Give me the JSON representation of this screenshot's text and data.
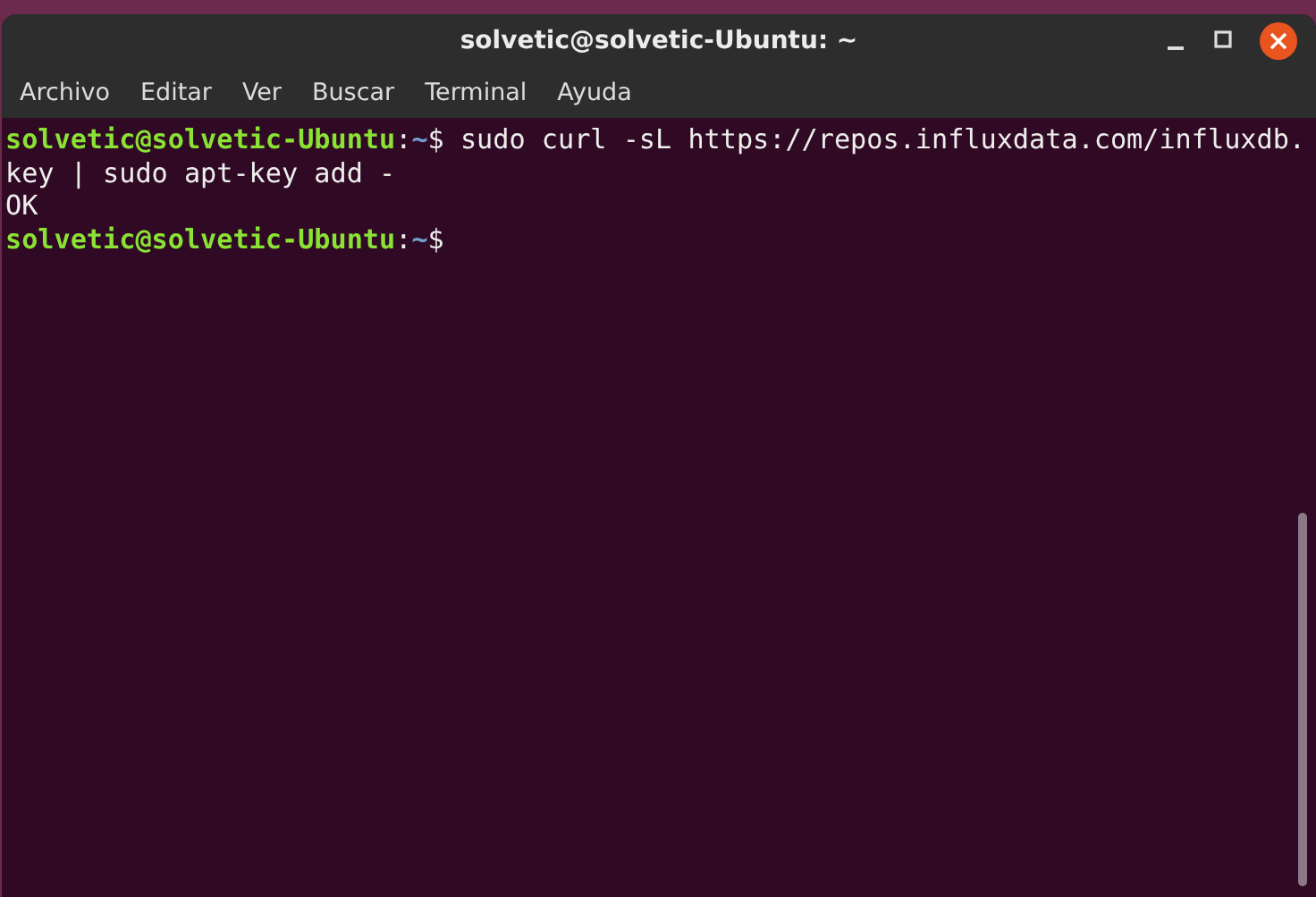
{
  "window": {
    "title": "solvetic@solvetic-Ubuntu: ~"
  },
  "menu": [
    "Archivo",
    "Editar",
    "Ver",
    "Buscar",
    "Terminal",
    "Ayuda"
  ],
  "terminal": {
    "lines": [
      {
        "kind": "prompt",
        "user": "solvetic@solvetic-Ubuntu",
        "separator": ":",
        "path": "~",
        "symbol": "$",
        "command": "sudo curl -sL https://repos.influxdata.com/influxdb."
      },
      {
        "kind": "output",
        "text": "key | sudo apt-key add -"
      },
      {
        "kind": "output",
        "text": "OK"
      },
      {
        "kind": "prompt",
        "user": "solvetic@solvetic-Ubuntu",
        "separator": ":",
        "path": "~",
        "symbol": "$"
      }
    ]
  }
}
